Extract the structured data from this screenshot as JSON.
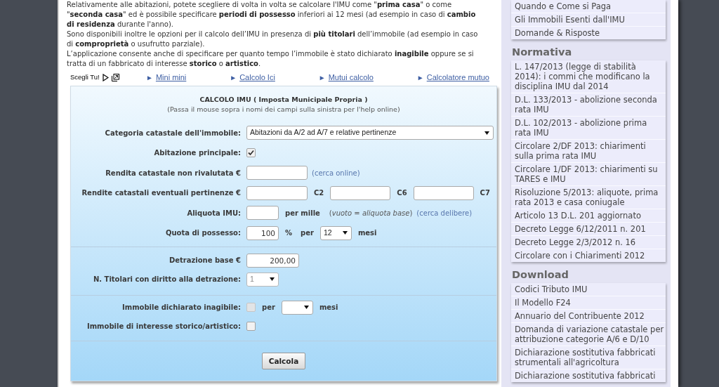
{
  "intro": {
    "paragraphs": [
      "Relativamente alle abitazioni, potete scegliere di volta in volta se calcolare l'IMU come \"**prima casa**\" o come \"**seconda casa**\" ed è possibile specificare **periodi di possesso** inferiori ai 12 mesi (ad esempio in caso di **cambio di residenza** durante l'anno).",
      "Sono disponibili inoltre le opzioni per il calcolo dell’IMU in presenza di **più titolari** dell’immobile (ad esempio in caso di **comproprietà** o usufrutto parziale).",
      "L’applicazione consente anche di specificare per quanto tempo l’immobile è stato dichiarato **inagibile** oppure se si tratta di un fabbricato di interesse **storico** o **artistico**."
    ]
  },
  "promo_bar": {
    "label": "Scegli Tu!",
    "links": [
      {
        "marker": "►",
        "label": "Mini mini"
      },
      {
        "marker": "►",
        "label": "Calcolo Ici"
      },
      {
        "marker": "►",
        "label": "Mutui calcolo"
      },
      {
        "marker": "►",
        "label": "Calcolatore mutuo"
      }
    ]
  },
  "calculator": {
    "title": "CALCOLO IMU ( Imposta Municipale Propria )",
    "subtitle": "(Passa il mouse sopra i nomi dei campi sulla sinistra per l'help online)",
    "sections": [
      {
        "rows": [
          {
            "label": "Categoria catastale dell'immobile:",
            "controls": [
              {
                "kind": "select",
                "value": "Abitazioni da A/2 ad A/7 e relative pertinenze",
                "disabled": false
              }
            ]
          },
          {
            "label": "Abitazione principale:",
            "controls": [
              {
                "kind": "checkbox",
                "checked": true,
                "disabled": false
              }
            ]
          },
          {
            "label": "Rendita catastale non rivalutata €",
            "controls": [
              {
                "kind": "input"
              },
              {
                "kind": "link",
                "text": "(cerca online)"
              }
            ]
          },
          {
            "label": "Rendite catastali eventuali pertinenze €",
            "controls": [
              {
                "kind": "input"
              },
              {
                "kind": "text",
                "text": "C2"
              },
              {
                "kind": "input"
              },
              {
                "kind": "text",
                "text": "C6"
              },
              {
                "kind": "input"
              },
              {
                "kind": "text",
                "text": "C7"
              }
            ]
          },
          {
            "label": "Aliquota IMU:",
            "controls": [
              {
                "kind": "input"
              },
              {
                "kind": "text",
                "text": "per mille"
              },
              {
                "kind": "note",
                "text": "(*vuoto = aliquota base*)"
              },
              {
                "kind": "link",
                "text": "(cerca delibere)"
              }
            ]
          },
          {
            "label": "Quota di possesso:",
            "controls": [
              {
                "kind": "input",
                "value": "100"
              },
              {
                "kind": "text",
                "text": "%"
              },
              {
                "kind": "text",
                "text": "per"
              },
              {
                "kind": "select",
                "value": "12",
                "disabled": false
              },
              {
                "kind": "text",
                "text": "mesi"
              }
            ]
          }
        ]
      },
      {
        "rows": [
          {
            "label": "Detrazione base €",
            "controls": [
              {
                "kind": "input",
                "value": "200,00"
              }
            ]
          },
          {
            "label": "N. Titolari con diritto alla detrazione:",
            "controls": [
              {
                "kind": "select",
                "value": "1",
                "disabled": true
              }
            ]
          }
        ]
      },
      {
        "rows": [
          {
            "label": "Immobile dichiarato inagibile:",
            "controls": [
              {
                "kind": "checkbox",
                "checked": false,
                "disabled": true
              },
              {
                "kind": "text",
                "text": "per"
              },
              {
                "kind": "select",
                "disabled": false
              },
              {
                "kind": "text",
                "text": "mesi"
              }
            ]
          },
          {
            "label": "Immobile di interesse storico/artistico:",
            "controls": [
              {
                "kind": "checkbox",
                "checked": false,
                "disabled": false
              }
            ]
          }
        ]
      }
    ],
    "submit": {
      "label": "Calcola"
    }
  },
  "sidebar": {
    "groups": [
      {
        "items": [
          "Quando e Come si Paga",
          "Gli Immobili Esenti dall'IMU",
          "Domande & Risposte"
        ]
      },
      {
        "heading": "Normativa",
        "items": [
          "L. 147/2013 (legge di stabilità 2014): i commi che modificano la disciplina IMU dal 2014",
          "D.L. 133/2013 - abolizione seconda rata IMU",
          "D.L. 102/2013 - abolizione prima rata IMU",
          "Circolare 2/DF 2013: chiarimenti sulla prima rata IMU",
          "Circolare 1/DF 2013: chiarimenti su TARES e IMU",
          "Risoluzione 5/2013: aliquote, prima rata 2013 e casa coniugale",
          "Articolo 13 D.L. 201 aggiornato",
          "Decreto Legge 6/12/2011 n. 201",
          "Decreto Legge 2/3/2012 n. 16",
          "Circolare con i Chiarimenti 2012"
        ]
      },
      {
        "heading": "Download",
        "items": [
          "Codici Tributo IMU",
          "Il Modello F24",
          "Annuario del Contribuente 2012",
          "Domanda di variazione catastale per attribuzione categorie A/6 e D/10",
          "Dichiarazione sostitutiva fabbricati strumentali all'agricoltura",
          "Dichiarazione sostitutiva fabbricati"
        ]
      }
    ]
  }
}
